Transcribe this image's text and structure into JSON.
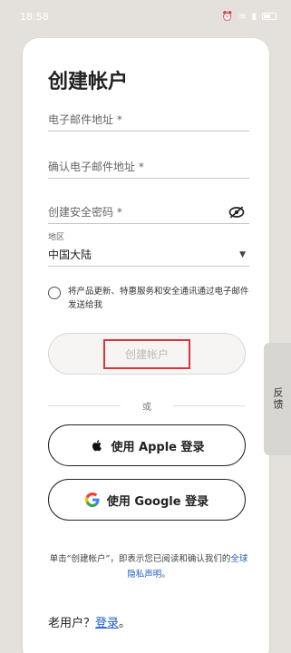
{
  "status_bar": {
    "time": "18:58"
  },
  "form": {
    "title": "创建帐户",
    "email_placeholder": "电子邮件地址 *",
    "confirm_email_placeholder": "确认电子邮件地址 *",
    "password_placeholder": "创建安全密码 *",
    "region_label": "地区",
    "region_value": "中国大陆",
    "consent_text": "将产品更新、特惠服务和安全通讯通过电子邮件发送给我",
    "create_button": "创建帐户",
    "or_label": "或",
    "apple_button": "使用 Apple 登录",
    "google_button": "使用 Google 登录",
    "legal_prefix": "单击“创建帐户”，即表示您已阅读和确认我们的",
    "legal_link": "全球隐私声明",
    "legal_suffix": "。",
    "returning_prefix": "老用户？",
    "login_link": "登录",
    "returning_suffix": "。"
  },
  "feedback": {
    "label": "反馈"
  },
  "colors": {
    "link": "#1f5ec7",
    "highlight": "#d7363a",
    "background": "#e4e1dc"
  }
}
